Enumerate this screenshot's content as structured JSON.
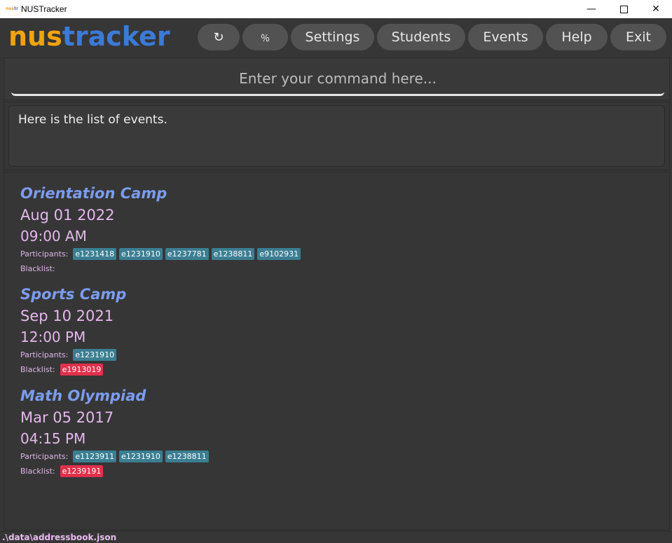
{
  "window": {
    "title": "NUSTracker",
    "icon_text_a": "nus",
    "icon_text_b": "tr",
    "minimize_glyph": "—",
    "close_glyph": "✕"
  },
  "logo": {
    "part1": "nus",
    "part2": "tracker"
  },
  "menu": {
    "refresh_icon": "↻",
    "percent_icon": "％",
    "settings": "Settings",
    "students": "Students",
    "events": "Events",
    "help": "Help",
    "exit": "Exit"
  },
  "command": {
    "placeholder": "Enter your command here...",
    "value": ""
  },
  "result": {
    "text": "Here is the list of events."
  },
  "labels": {
    "participants": "Participants:",
    "blacklist": "Blacklist:"
  },
  "events": [
    {
      "name": "Orientation Camp",
      "date": "Aug 01 2022",
      "time": "09:00 AM",
      "participants": [
        "e1231418",
        "e1231910",
        "e1237781",
        "e1238811",
        "e9102931"
      ],
      "blacklist": []
    },
    {
      "name": "Sports Camp",
      "date": "Sep 10 2021",
      "time": "12:00 PM",
      "participants": [
        "e1231910"
      ],
      "blacklist": [
        "e1913019"
      ]
    },
    {
      "name": "Math Olympiad",
      "date": "Mar 05 2017",
      "time": "04:15 PM",
      "participants": [
        "e1123911",
        "e1231910",
        "e1238811"
      ],
      "blacklist": [
        "e1239191"
      ]
    }
  ],
  "status": {
    "path": ".\\data\\addressbook.json"
  },
  "colors": {
    "logo_orange": "#f0a30f",
    "logo_blue": "#3b7bd8",
    "event_name": "#7b9cf0",
    "event_date": "#e6b8ee",
    "participant_tag": "#3b7e92",
    "blacklist_tag": "#e1304c"
  }
}
